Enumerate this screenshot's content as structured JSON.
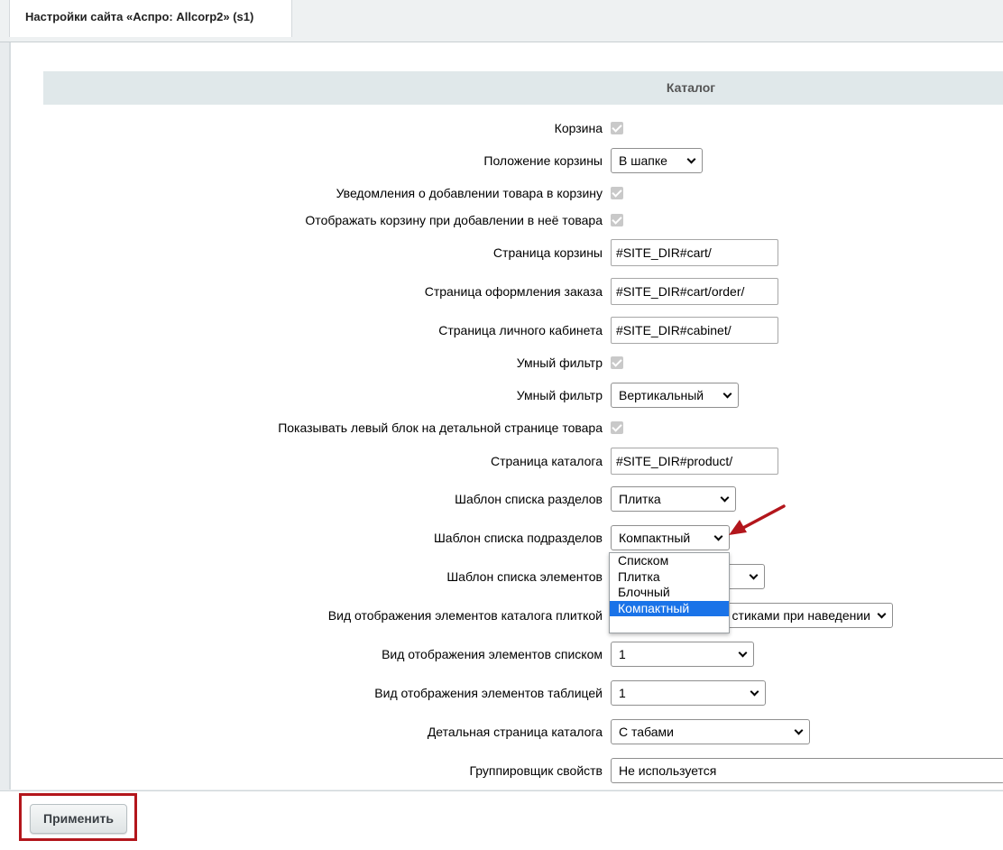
{
  "tab": {
    "title": "Настройки сайта «Аспро: Allcorp2» (s1)"
  },
  "section": {
    "title": "Каталог"
  },
  "fields": {
    "basket": {
      "label": "Корзина"
    },
    "basket_position": {
      "label": "Положение корзины",
      "value": "В шапке"
    },
    "basket_notify": {
      "label": "Уведомления о добавлении товара в корзину"
    },
    "basket_show": {
      "label": "Отображать корзину при добавлении в неё товара"
    },
    "basket_page": {
      "label": "Страница корзины",
      "value": "#SITE_DIR#cart/"
    },
    "order_page": {
      "label": "Страница оформления заказа",
      "value": "#SITE_DIR#cart/order/"
    },
    "cabinet_page": {
      "label": "Страница личного кабинета",
      "value": "#SITE_DIR#cabinet/"
    },
    "smart_filter": {
      "label": "Умный фильтр"
    },
    "smart_filter_type": {
      "label": "Умный фильтр",
      "value": "Вертикальный"
    },
    "left_block": {
      "label": "Показывать левый блок на детальной странице товара"
    },
    "catalog_page": {
      "label": "Страница каталога",
      "value": "#SITE_DIR#product/"
    },
    "sections_template": {
      "label": "Шаблон списка разделов",
      "value": "Плитка"
    },
    "subsections_template": {
      "label": "Шаблон списка подразделов",
      "value": "Компактный"
    },
    "elements_template": {
      "label": "Шаблон списка элементов",
      "value": ""
    },
    "tile_view": {
      "label": "Вид отображения элементов каталога плиткой",
      "value": "стиками при наведении"
    },
    "list_view": {
      "label": "Вид отображения элементов списком",
      "value": "1"
    },
    "table_view": {
      "label": "Вид отображения элементов таблицей",
      "value": "1"
    },
    "detail_page": {
      "label": "Детальная страница каталога",
      "value": "С табами"
    },
    "grouper": {
      "label": "Группировщик свойств",
      "value": "Не используется"
    }
  },
  "dropdown": {
    "options": [
      "Списком",
      "Плитка",
      "Блочный",
      "Компактный"
    ],
    "selected": "Компактный"
  },
  "footer": {
    "apply_label": "Применить"
  },
  "colors": {
    "highlight": "#b3161c",
    "selected_option": "#1a73e8"
  }
}
